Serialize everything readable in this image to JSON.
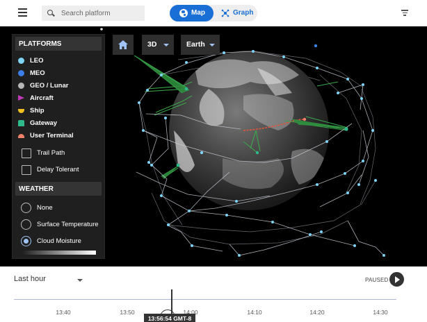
{
  "search": {
    "placeholder": "Search platform"
  },
  "view_toggle": {
    "map_label": "Map",
    "graph_label": "Graph"
  },
  "map_controls": {
    "mode": "3D",
    "body": "Earth"
  },
  "platforms": {
    "title": "PLATFORMS",
    "items": [
      {
        "label": "LEO",
        "color": "#7fd3f7",
        "icon": "leo-dot-icon"
      },
      {
        "label": "MEO",
        "color": "#3b7fe8",
        "icon": "meo-dot-icon"
      },
      {
        "label": "GEO / Lunar",
        "color": "#b8b8b8",
        "icon": "geo-dot-icon"
      },
      {
        "label": "Aircraft",
        "color": "#c03ab8",
        "icon": "aircraft-triangle-icon"
      },
      {
        "label": "Ship",
        "color": "#f0c020",
        "icon": "ship-icon"
      },
      {
        "label": "Gateway",
        "color": "#2fb98a",
        "icon": "gateway-icon"
      },
      {
        "label": "User Terminal",
        "color": "#f0826a",
        "icon": "user-terminal-icon"
      }
    ],
    "options": [
      {
        "label": "Trail Path",
        "checked": false
      },
      {
        "label": "Delay Tolerant",
        "checked": false
      }
    ]
  },
  "weather": {
    "title": "WEATHER",
    "options": [
      {
        "label": "None",
        "selected": false
      },
      {
        "label": "Surface Temperature",
        "selected": false
      },
      {
        "label": "Cloud Moisture",
        "selected": true
      }
    ]
  },
  "timeline": {
    "range": "Last hour",
    "status": "PAUSED",
    "ticks": [
      "13:40",
      "13:50",
      "14:00",
      "14:10",
      "14:20",
      "14:30"
    ],
    "current_time": "13:56:54 GMT-8"
  }
}
